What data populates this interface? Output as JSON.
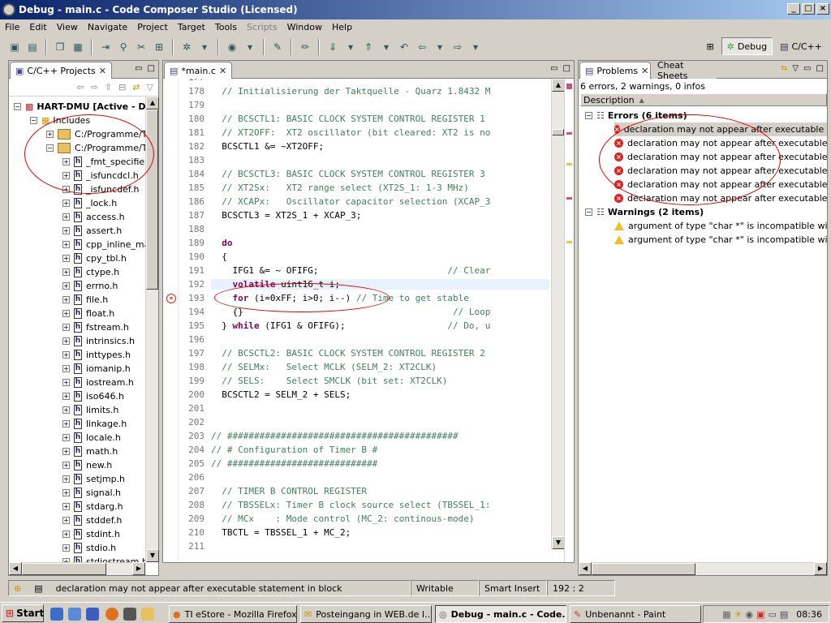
{
  "window": {
    "title": "Debug - main.c - Code Composer Studio (Licensed)"
  },
  "menu": [
    "File",
    "Edit",
    "View",
    "Navigate",
    "Project",
    "Target",
    "Tools",
    "Scripts",
    "Window",
    "Help"
  ],
  "perspectives": {
    "debug": "Debug",
    "cpp": "C/C++"
  },
  "projects": {
    "tab_label": "C/C++ Projects",
    "project": "HART-DMU [Active - D",
    "includes": "Includes",
    "paths": [
      "C:/Programme/Te",
      "C:/Programme/Te"
    ],
    "files": [
      "_fmt_specifier",
      "_isfuncdcl.h",
      "_isfuncdef.h",
      "_lock.h",
      "access.h",
      "assert.h",
      "cpp_inline_ma",
      "cpy_tbl.h",
      "ctype.h",
      "errno.h",
      "file.h",
      "float.h",
      "fstream.h",
      "intrinsics.h",
      "inttypes.h",
      "iomanip.h",
      "iostream.h",
      "iso646.h",
      "limits.h",
      "linkage.h",
      "locale.h",
      "math.h",
      "new.h",
      "setjmp.h",
      "signal.h",
      "stdarg.h",
      "stddef.h",
      "stdint.h",
      "stdio.h",
      "stdiostream.h"
    ]
  },
  "editor": {
    "tab_label": "*main.c",
    "lines": [
      {
        "n": "177",
        "t": ""
      },
      {
        "n": "178",
        "t": "  // Initialisierung der Taktquelle - Quarz 1.8432 M"
      },
      {
        "n": "179",
        "t": ""
      },
      {
        "n": "180",
        "t": "  // BCSCTL1: BASIC CLOCK SYSTEM CONTROL REGISTER 1"
      },
      {
        "n": "181",
        "t": "  // XT2OFF:  XT2 oscillator (bit cleared: XT2 is no"
      },
      {
        "n": "182",
        "t": "  BCSCTL1 &= ~XT2OFF;"
      },
      {
        "n": "183",
        "t": ""
      },
      {
        "n": "184",
        "t": "  // BCSCTL3: BASIC CLOCK SYSTEM CONTROL REGISTER 3"
      },
      {
        "n": "185",
        "t": "  // XT2Sx:   XT2 range select (XT2S_1: 1-3 MHz)"
      },
      {
        "n": "186",
        "t": "  // XCAPx:   Oscillator capacitor selection (XCAP_3"
      },
      {
        "n": "187",
        "t": "  BCSCTL3 = XT2S_1 + XCAP_3;"
      },
      {
        "n": "188",
        "t": ""
      },
      {
        "n": "189",
        "t": "  do"
      },
      {
        "n": "190",
        "t": "  {"
      },
      {
        "n": "191",
        "t": "    IFG1 &= ~ OFIFG;                        // Clear"
      },
      {
        "n": "192",
        "t": "    volatile uint16_t i;"
      },
      {
        "n": "193",
        "t": "    for (i=0xFF; i>0; i--) // Time to get stable"
      },
      {
        "n": "194",
        "t": "    {}                                       // Loop"
      },
      {
        "n": "195",
        "t": "  } while (IFG1 & OFIFG);                   // Do, u"
      },
      {
        "n": "196",
        "t": ""
      },
      {
        "n": "197",
        "t": "  // BCSCTL2: BASIC CLOCK SYSTEM CONTROL REGISTER 2"
      },
      {
        "n": "198",
        "t": "  // SELMx:   Select MCLK (SELM_2: XT2CLK)"
      },
      {
        "n": "199",
        "t": "  // SELS:    Select SMCLK (bit set: XT2CLK)"
      },
      {
        "n": "200",
        "t": "  BCSCTL2 = SELM_2 + SELS;"
      },
      {
        "n": "201",
        "t": ""
      },
      {
        "n": "202",
        "t": ""
      },
      {
        "n": "203",
        "t": "// ###########################################"
      },
      {
        "n": "204",
        "t": "// # Configuration of Timer B #"
      },
      {
        "n": "205",
        "t": "// ############################"
      },
      {
        "n": "206",
        "t": ""
      },
      {
        "n": "207",
        "t": "  // TIMER B CONTROL REGISTER"
      },
      {
        "n": "208",
        "t": "  // TBSSELx: Timer B clock source select (TBSSEL_1:"
      },
      {
        "n": "209",
        "t": "  // MCx    : Mode control (MC_2: continous-mode)"
      },
      {
        "n": "210",
        "t": "  TBCTL = TBSSEL_1 + MC_2;"
      },
      {
        "n": "211",
        "t": ""
      }
    ]
  },
  "problems": {
    "tab_label": "Problems",
    "tab2_label": "Cheat Sheets",
    "summary": "6 errors, 2 warnings, 0 infos",
    "column": "Description",
    "errors_label": "Errors (6 items)",
    "errors": [
      "declaration may not appear after executable stat",
      "declaration may not appear after executable stat",
      "declaration may not appear after executable stat",
      "declaration may not appear after executable stat",
      "declaration may not appear after executable stat",
      "declaration may not appear after executable stat"
    ],
    "warnings_label": "Warnings (2 items)",
    "warnings": [
      "argument of type \"char *\" is incompatible with par",
      "argument of type \"char *\" is incompatible with par"
    ]
  },
  "status": {
    "message": "declaration may not appear after executable statement in block",
    "writable": "Writable",
    "insert": "Smart Insert",
    "position": "192 : 2"
  },
  "taskbar": {
    "start": "Start",
    "tasks": [
      "TI eStore - Mozilla Firefox",
      "Posteingang in WEB.de I...",
      "Debug - main.c - Code...",
      "Unbenannt - Paint"
    ],
    "clock": "08:36"
  }
}
